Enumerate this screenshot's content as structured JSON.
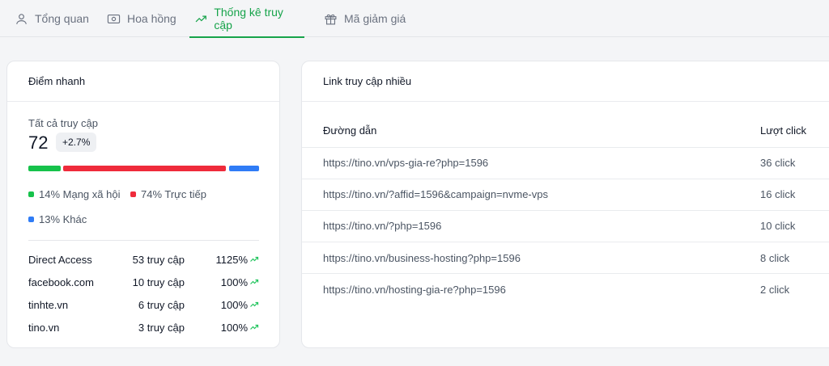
{
  "tabs": [
    {
      "label": "Tổng quan",
      "icon": "user-icon",
      "active": false
    },
    {
      "label": "Hoa hồng",
      "icon": "money-icon",
      "active": false
    },
    {
      "label": "Thống kê truy cập",
      "icon": "trending-up-icon",
      "active": true
    },
    {
      "label": "Mã giảm giá",
      "icon": "gift-icon",
      "active": false
    }
  ],
  "quick": {
    "title": "Điểm nhanh",
    "label": "Tất cả truy cập",
    "total": "72",
    "change": "+2.7%",
    "segments": [
      {
        "label": "14% Mạng xã hội",
        "percent": 14,
        "color": "#16c24b"
      },
      {
        "label": "74% Trực tiếp",
        "percent": 74,
        "color": "#ef2b3b"
      },
      {
        "label": "13% Khác",
        "percent": 13,
        "color": "#2f7cf6"
      }
    ],
    "sources": [
      {
        "name": "Direct Access",
        "visits": "53 truy cập",
        "percent": "1125%"
      },
      {
        "name": "facebook.com",
        "visits": "10 truy cập",
        "percent": "100%"
      },
      {
        "name": "tinhte.vn",
        "visits": "6 truy cập",
        "percent": "100%"
      },
      {
        "name": "tino.vn",
        "visits": "3 truy cập",
        "percent": "100%"
      }
    ]
  },
  "links": {
    "title": "Link truy cập nhiều",
    "col_path": "Đường dẫn",
    "col_clicks": "Lượt click",
    "rows": [
      {
        "url": "https://tino.vn/vps-gia-re?php=1596",
        "clicks": "36 click"
      },
      {
        "url": "https://tino.vn/?affid=1596&campaign=nvme-vps",
        "clicks": "16 click"
      },
      {
        "url": "https://tino.vn/?php=1596",
        "clicks": "10 click"
      },
      {
        "url": "https://tino.vn/business-hosting?php=1596",
        "clicks": "8 click"
      },
      {
        "url": "https://tino.vn/hosting-gia-re?php=1596",
        "clicks": "2 click"
      }
    ]
  },
  "colors": {
    "accent": "#16a34a",
    "trend": "#22c55e"
  }
}
